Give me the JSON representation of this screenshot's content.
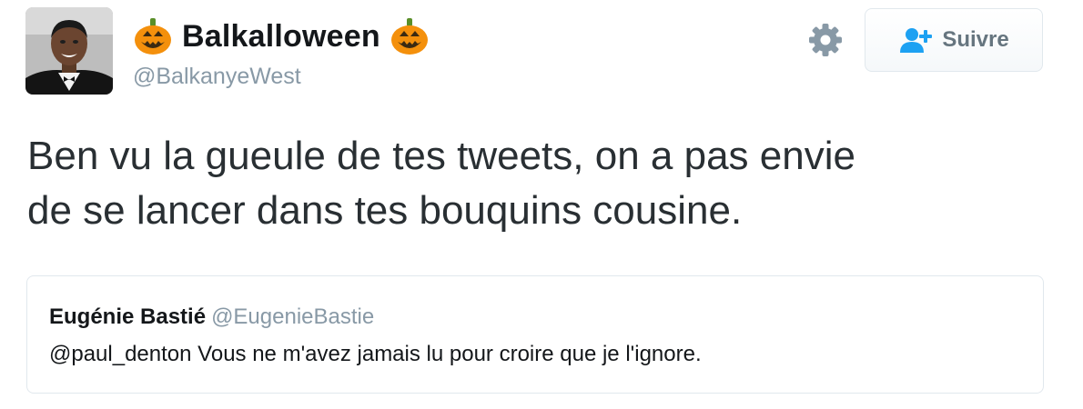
{
  "user": {
    "display_name": "Balkalloween",
    "handle": "@BalkanyeWest",
    "name_icon": "jack-o-lantern"
  },
  "follow_button": {
    "label": "Suivre",
    "icon": "add-user-icon"
  },
  "settings_icon": "gear-icon",
  "tweet": {
    "line1": "Ben vu la gueule de tes tweets, on a pas envie",
    "line2": "de se lancer dans tes bouquins cousine."
  },
  "quoted_tweet": {
    "name": "Eugénie Bastié",
    "handle": "@EugenieBastie",
    "text": "@paul_denton Vous ne m'avez jamais lu pour croire que je l'ignore."
  },
  "colors": {
    "accent": "#1da1f2",
    "muted": "#8899a6",
    "pumpkin": "#f4900c"
  }
}
